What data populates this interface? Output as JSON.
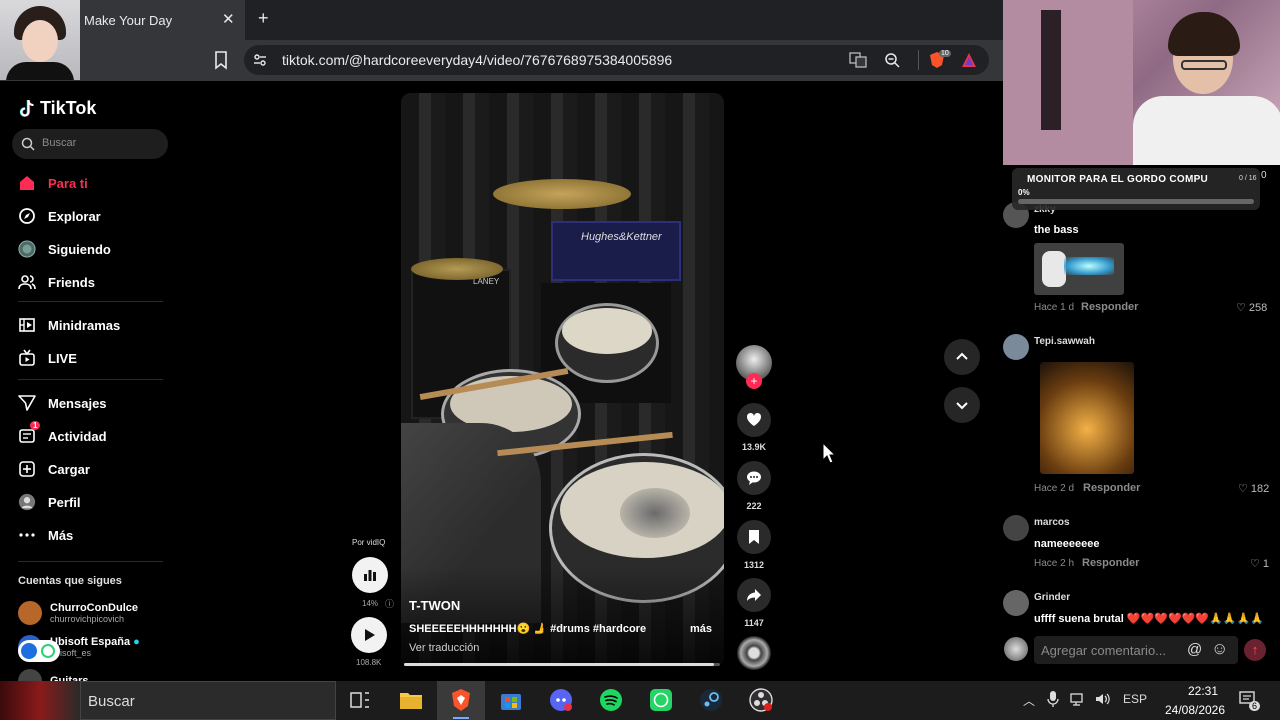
{
  "browser": {
    "tab_title": "Make Your Day",
    "tab_close": "✕",
    "new_tab": "+",
    "url": "tiktok.com/@hardcoreeveryday4/video/7676768975384005896",
    "extension_badge": "10"
  },
  "sidebar": {
    "logo": "TikTok",
    "search_placeholder": "Buscar",
    "nav": [
      {
        "label": "Para ti",
        "icon": "home-icon",
        "active": true
      },
      {
        "label": "Explorar",
        "icon": "compass-icon"
      },
      {
        "label": "Siguiendo",
        "icon": "following-avatar-icon"
      },
      {
        "label": "Friends",
        "icon": "friends-icon"
      },
      {
        "label": "Minidramas",
        "icon": "film-icon"
      },
      {
        "label": "LIVE",
        "icon": "live-tv-icon"
      },
      {
        "label": "Mensajes",
        "icon": "send-icon"
      },
      {
        "label": "Actividad",
        "icon": "inbox-icon",
        "badge": "1"
      },
      {
        "label": "Cargar",
        "icon": "upload-plus-icon"
      },
      {
        "label": "Perfil",
        "icon": "profile-icon"
      },
      {
        "label": "Más",
        "icon": "more-dots-icon"
      }
    ],
    "following_title": "Cuentas que sigues",
    "following": [
      {
        "name": "ChurroConDulce",
        "handle": "churrovichpicovich",
        "avatar_color": "#b8672a"
      },
      {
        "name": "Ubisoft España",
        "handle": "ubisoft_es",
        "avatar_color": "#2b5fc9",
        "verified": true
      },
      {
        "name": "Guitars",
        "handle": "",
        "avatar_color": "#444"
      }
    ]
  },
  "video": {
    "amp_brand": "Hughes&Kettner",
    "cab_brand": "LANEY",
    "author": "T-TWON",
    "description": "SHEEEEEHHHHHHH😮 🫸 #drums #hardcore ...",
    "more": "más",
    "translate": "Ver traducción",
    "progress": 0.98
  },
  "actions": {
    "likes": "13.9K",
    "comments": "222",
    "saves": "1312",
    "shares": "1147",
    "follow": "+"
  },
  "vidiq": {
    "label": "Por vidIQ",
    "percent": "14%",
    "info": "ⓘ",
    "views": "108.8K"
  },
  "stream_overlay": {
    "goal_title": "MONITOR PARA EL GORDO COMPU",
    "goal_count": "0 / 16",
    "goal_percent": "0%",
    "goal_extra": "0"
  },
  "comments": [
    {
      "user": "zkky",
      "text": "the bass",
      "time": "Hace 1 d",
      "reply": "Responder",
      "likes": "258",
      "avatar_color": "#555"
    },
    {
      "user": "Tepi.sawwah",
      "text": "",
      "time": "Hace 2 d",
      "reply": "Responder",
      "likes": "182",
      "avatar_color": "#7a8a9a"
    },
    {
      "user": "marcos",
      "text": "nameeeeeee",
      "time": "Hace 2 h",
      "reply": "Responder",
      "likes": "1",
      "avatar_color": "#444"
    },
    {
      "user": "Grinder",
      "text": "uffff suena brutal ❤️❤️❤️❤️❤️❤️🙏🙏🙏🙏",
      "avatar_color": "#666"
    }
  ],
  "comment_input": {
    "placeholder": "Agregar comentario...",
    "mention": "@",
    "emoji": "☺",
    "send": "↑"
  },
  "taskbar": {
    "search": "Buscar",
    "lang": "ESP",
    "time": "22:31",
    "date": "24/08/2026",
    "notifications": "6"
  }
}
